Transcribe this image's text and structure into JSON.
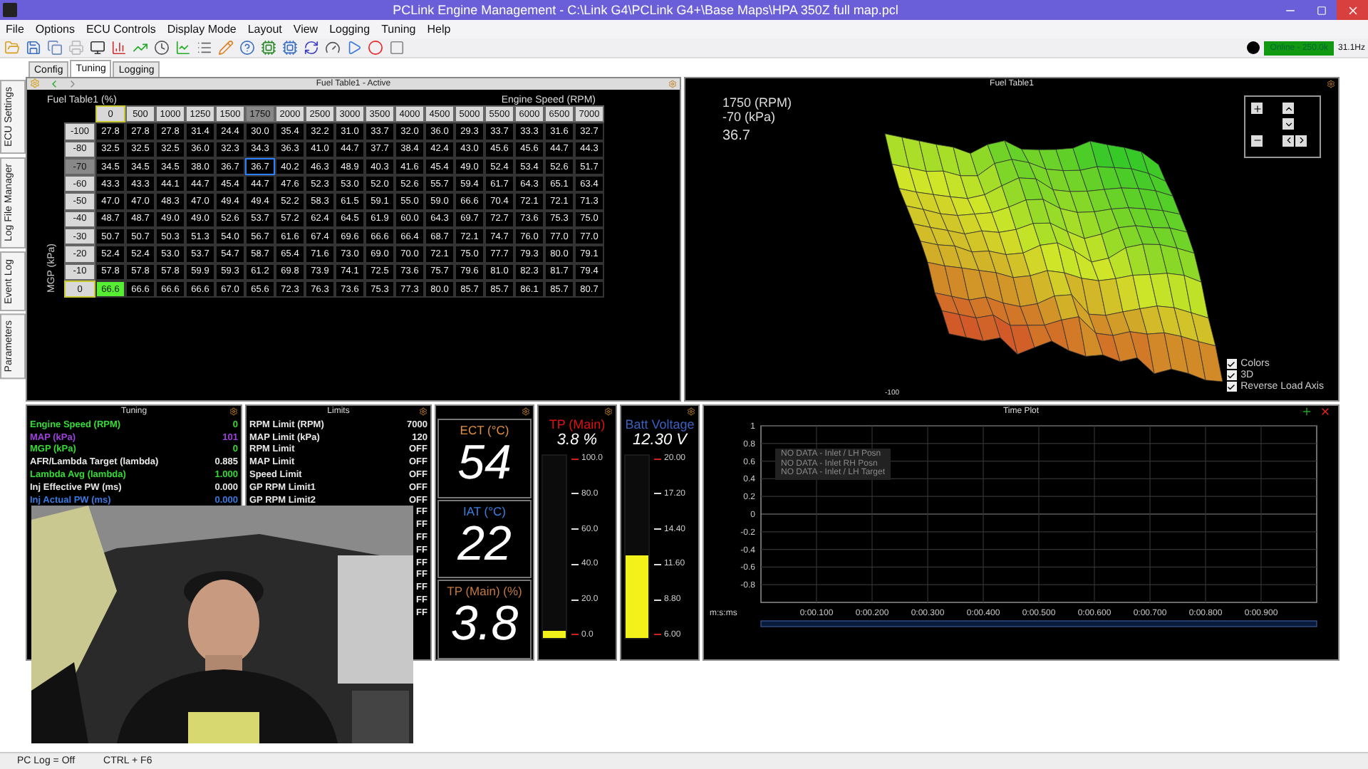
{
  "window": {
    "title": "PCLink Engine Management - C:\\Link G4\\PCLink G4+\\Base Maps\\HPA 350Z full map.pcl"
  },
  "menu": [
    "File",
    "Options",
    "ECU Controls",
    "Display Mode",
    "Layout",
    "View",
    "Logging",
    "Tuning",
    "Help"
  ],
  "connection": {
    "status": "Online - 250.0k",
    "rate": "31.1Hz"
  },
  "tabs": [
    {
      "label": "Config",
      "selected": false
    },
    {
      "label": "Tuning",
      "selected": true
    },
    {
      "label": "Logging",
      "selected": false
    }
  ],
  "side_tabs": [
    "ECU Settings",
    "Log File Manager",
    "Event Log",
    "Parameters"
  ],
  "fuel_table": {
    "title": "Fuel Table1 - Active",
    "name": "Fuel Table1 (%)",
    "x_axis": "Engine Speed (RPM)",
    "y_axis": "MGP (kPa)",
    "columns": [
      {
        "label": "0",
        "selected": false,
        "live": true
      },
      {
        "label": "500",
        "selected": false,
        "live": false
      },
      {
        "label": "1000",
        "selected": false,
        "live": false
      },
      {
        "label": "1250",
        "selected": false,
        "live": false
      },
      {
        "label": "1500",
        "selected": false,
        "live": false
      },
      {
        "label": "1750",
        "selected": true,
        "live": false
      },
      {
        "label": "2000",
        "selected": false,
        "live": false
      },
      {
        "label": "2500",
        "selected": false,
        "live": false
      },
      {
        "label": "3000",
        "selected": false,
        "live": false
      },
      {
        "label": "3500",
        "selected": false,
        "live": false
      },
      {
        "label": "4000",
        "selected": false,
        "live": false
      },
      {
        "label": "4500",
        "selected": false,
        "live": false
      },
      {
        "label": "5000",
        "selected": false,
        "live": false
      },
      {
        "label": "5500",
        "selected": false,
        "live": false
      },
      {
        "label": "6000",
        "selected": false,
        "live": false
      },
      {
        "label": "6500",
        "selected": false,
        "live": false
      },
      {
        "label": "7000",
        "selected": false,
        "live": false
      }
    ],
    "rows": [
      {
        "label": "-100",
        "selected": false,
        "live": false,
        "cells": [
          "27.8",
          "27.8",
          "27.8",
          "31.4",
          "24.4",
          "30.0",
          "35.4",
          "32.2",
          "31.0",
          "33.7",
          "32.0",
          "36.0",
          "29.3",
          "33.7",
          "33.3",
          "31.6",
          "32.7"
        ]
      },
      {
        "label": "-80",
        "selected": false,
        "live": false,
        "cells": [
          "32.5",
          "32.5",
          "32.5",
          "36.0",
          "32.3",
          "34.3",
          "36.3",
          "41.0",
          "44.7",
          "37.7",
          "38.4",
          "42.4",
          "43.0",
          "45.6",
          "45.6",
          "44.7",
          "44.3"
        ]
      },
      {
        "label": "-70",
        "selected": true,
        "live": false,
        "cells": [
          "34.5",
          "34.5",
          "34.5",
          "38.0",
          "36.7",
          "36.7",
          "40.2",
          "46.3",
          "48.9",
          "40.3",
          "41.6",
          "45.4",
          "49.0",
          "52.4",
          "53.4",
          "52.6",
          "51.7"
        ]
      },
      {
        "label": "-60",
        "selected": false,
        "live": false,
        "cells": [
          "43.3",
          "43.3",
          "44.1",
          "44.7",
          "45.4",
          "44.7",
          "47.6",
          "52.3",
          "53.0",
          "52.0",
          "52.6",
          "55.7",
          "59.4",
          "61.7",
          "64.3",
          "65.1",
          "63.4"
        ]
      },
      {
        "label": "-50",
        "selected": false,
        "live": false,
        "cells": [
          "47.0",
          "47.0",
          "48.3",
          "47.0",
          "49.4",
          "49.4",
          "52.2",
          "58.3",
          "61.5",
          "59.1",
          "55.0",
          "59.0",
          "66.6",
          "70.4",
          "72.1",
          "72.1",
          "71.3"
        ]
      },
      {
        "label": "-40",
        "selected": false,
        "live": false,
        "cells": [
          "48.7",
          "48.7",
          "49.0",
          "49.0",
          "52.6",
          "53.7",
          "57.2",
          "62.4",
          "64.5",
          "61.9",
          "60.0",
          "64.3",
          "69.7",
          "72.7",
          "73.6",
          "75.3",
          "75.0"
        ]
      },
      {
        "label": "-30",
        "selected": false,
        "live": false,
        "cells": [
          "50.7",
          "50.7",
          "50.3",
          "51.3",
          "54.0",
          "56.7",
          "61.6",
          "67.4",
          "69.6",
          "66.6",
          "66.4",
          "68.7",
          "72.1",
          "74.7",
          "76.0",
          "77.0",
          "77.0"
        ]
      },
      {
        "label": "-20",
        "selected": false,
        "live": false,
        "cells": [
          "52.4",
          "52.4",
          "53.0",
          "53.7",
          "54.7",
          "58.7",
          "65.4",
          "71.6",
          "73.0",
          "69.0",
          "70.0",
          "72.1",
          "75.0",
          "77.7",
          "79.3",
          "80.0",
          "79.1"
        ]
      },
      {
        "label": "-10",
        "selected": false,
        "live": false,
        "cells": [
          "57.8",
          "57.8",
          "57.8",
          "59.9",
          "59.3",
          "61.2",
          "69.8",
          "73.9",
          "74.1",
          "72.5",
          "73.6",
          "75.7",
          "79.6",
          "81.0",
          "82.3",
          "81.7",
          "79.4"
        ]
      },
      {
        "label": "0",
        "selected": false,
        "live": true,
        "cells": [
          "66.6",
          "66.6",
          "66.6",
          "66.6",
          "67.0",
          "65.6",
          "72.3",
          "76.3",
          "73.6",
          "75.3",
          "77.3",
          "80.0",
          "85.7",
          "85.7",
          "86.1",
          "85.7",
          "80.7"
        ]
      }
    ]
  },
  "surface": {
    "title": "Fuel Table1",
    "rpm": "1750 (RPM)",
    "load": "-70 (kPa)",
    "value": "36.7",
    "axis_label": "-100",
    "options": [
      {
        "label": "Colors",
        "checked": true
      },
      {
        "label": "3D",
        "checked": true
      },
      {
        "label": "Reverse Load Axis",
        "checked": true
      }
    ]
  },
  "tuning": {
    "title": "Tuning",
    "rows": [
      {
        "label": "Engine Speed (RPM)",
        "value": "0",
        "color": "#33dd33"
      },
      {
        "label": "MAP (kPa)",
        "value": "101",
        "color": "#a040e0"
      },
      {
        "label": "MGP (kPa)",
        "value": "0",
        "color": "#33dd33"
      },
      {
        "label": "AFR/Lambda Target (lambda)",
        "value": "0.885",
        "color": "#e8e8e8"
      },
      {
        "label": "Lambda Avg (lambda)",
        "value": "1.000",
        "color": "#33dd33"
      },
      {
        "label": "Inj Effective PW (ms)",
        "value": "0.000",
        "color": "#e8e8e8"
      },
      {
        "label": "Inj Actual PW (ms)",
        "value": "0.000",
        "color": "#3a7ae0"
      }
    ]
  },
  "limits": {
    "title": "Limits",
    "rows": [
      {
        "label": "RPM Limit (RPM)",
        "value": "7000"
      },
      {
        "label": "MAP Limit (kPa)",
        "value": "120"
      },
      {
        "label": "RPM Limit",
        "value": "OFF"
      },
      {
        "label": "MAP Limit",
        "value": "OFF"
      },
      {
        "label": "Speed Limit",
        "value": "OFF"
      },
      {
        "label": "GP RPM Limit1",
        "value": "OFF"
      },
      {
        "label": "GP RPM Limit2",
        "value": "OFF"
      }
    ],
    "partly_hidden_values": [
      "FF",
      "FF",
      "FF",
      "FF",
      "FF",
      "FF",
      "FF",
      "FF",
      "FF"
    ]
  },
  "digital_gauges": [
    {
      "label": "ECT (°C)",
      "value": "54",
      "color": "#e09040"
    },
    {
      "label": "IAT (°C)",
      "value": "22",
      "color": "#3a80e0"
    },
    {
      "label": "TP (Main) (%)",
      "value": "3.8",
      "color": "#c07840"
    }
  ],
  "bar_gauges": [
    {
      "label": "TP (Main)",
      "reading": "3.8 %",
      "color": "#dd1111",
      "level": 0.038,
      "ticks": [
        "100.0",
        "80.0",
        "60.0",
        "40.0",
        "20.0",
        "0.0"
      ]
    },
    {
      "label": "Batt Voltage",
      "reading": "12.30 V",
      "color": "#3a60c0",
      "level": 0.45,
      "ticks": [
        "20.00",
        "17.20",
        "14.40",
        "11.60",
        "8.80",
        "6.00"
      ]
    }
  ],
  "time_plot": {
    "title": "Time Plot",
    "legend": [
      "NO DATA - Inlet / LH Posn",
      "NO DATA - Inlet RH Posn",
      "NO DATA - Inlet / LH Target"
    ],
    "chart_data": {
      "type": "line",
      "xlabel": "m:s:ms",
      "ylim": [
        -1,
        1
      ],
      "grid": true,
      "categories": [
        "0:00.100",
        "0:00.200",
        "0:00.300",
        "0:00.400",
        "0:00.500",
        "0:00.600",
        "0:00.700",
        "0:00.800",
        "0:00.900"
      ],
      "yticks": [
        {
          "value": 1,
          "label": "1"
        },
        {
          "value": 0.8,
          "label": "0.8"
        },
        {
          "value": 0.6,
          "label": "0.6"
        },
        {
          "value": 0.4,
          "label": "0.4"
        },
        {
          "value": 0.2,
          "label": "0.2"
        },
        {
          "value": 0,
          "label": "0"
        },
        {
          "value": -0.2,
          "label": "-0.2"
        },
        {
          "value": -0.4,
          "label": "-0.4"
        },
        {
          "value": -0.6,
          "label": "-0.6"
        },
        {
          "value": -0.8,
          "label": "-0.8"
        }
      ]
    }
  },
  "webcam": {
    "kind": "picture"
  },
  "status_bar": [
    "PC Log = Off",
    "CTRL + F6"
  ]
}
